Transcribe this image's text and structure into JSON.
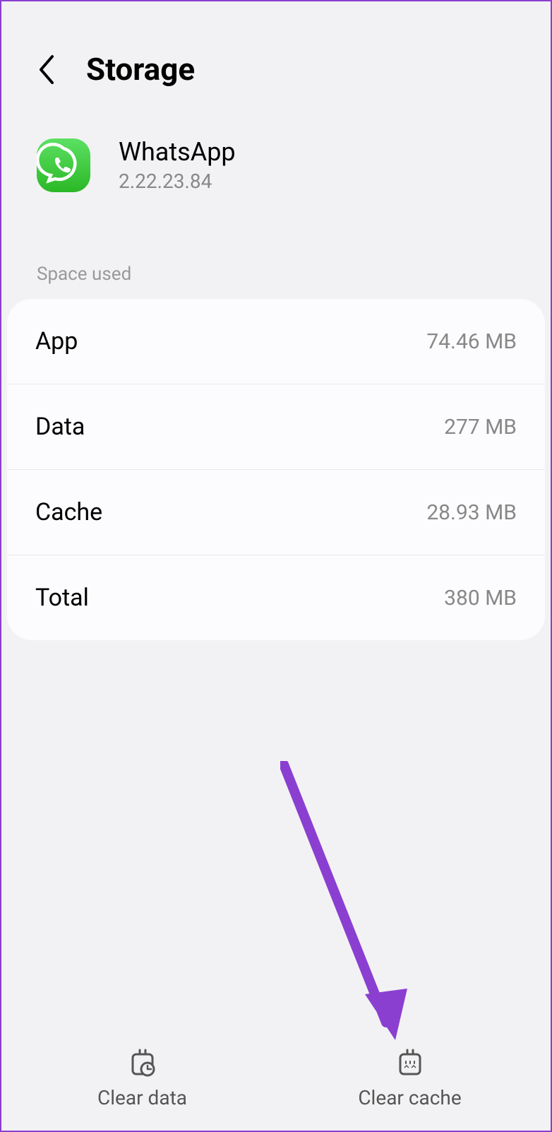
{
  "header": {
    "title": "Storage"
  },
  "app": {
    "name": "WhatsApp",
    "version": "2.22.23.84"
  },
  "section": {
    "label": "Space used"
  },
  "rows": [
    {
      "label": "App",
      "value": "74.46 MB"
    },
    {
      "label": "Data",
      "value": "277 MB"
    },
    {
      "label": "Cache",
      "value": "28.93 MB"
    },
    {
      "label": "Total",
      "value": "380 MB"
    }
  ],
  "bottom": {
    "clear_data": "Clear data",
    "clear_cache": "Clear cache"
  }
}
